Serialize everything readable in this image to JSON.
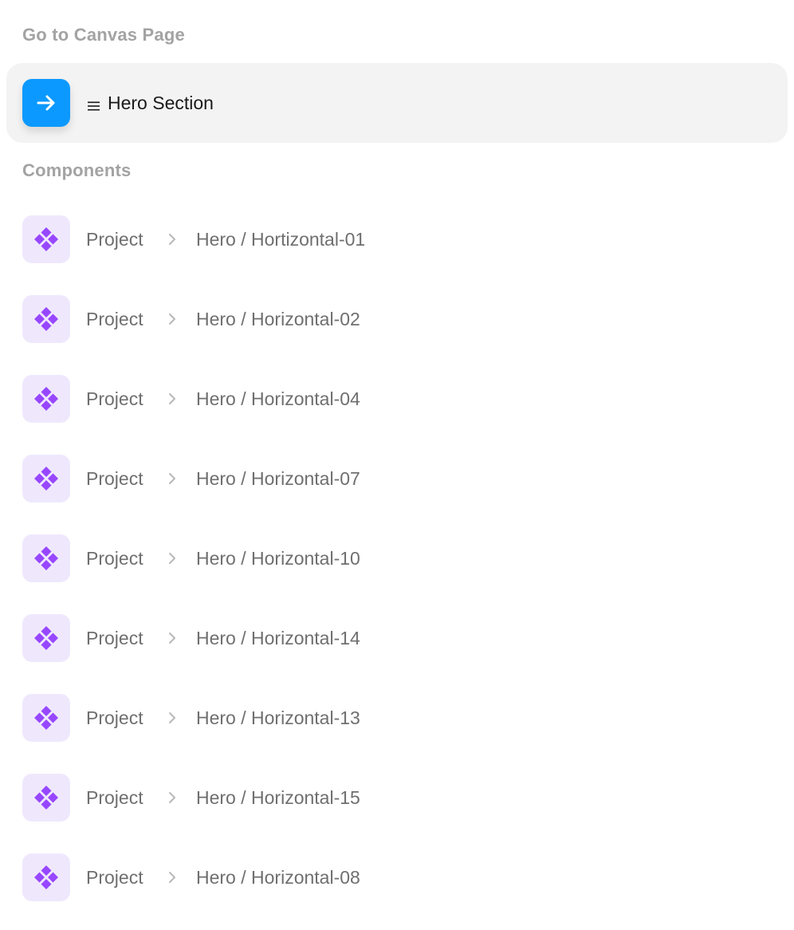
{
  "goto_section": {
    "heading": "Go to Canvas Page",
    "selected": {
      "icon": "arrow-right-icon",
      "frame_icon": "frame-lines-icon",
      "label": "Hero Section"
    }
  },
  "components_section": {
    "heading": "Components",
    "icon": "component-diamond-icon",
    "separator_icon": "chevron-right-icon",
    "items": [
      {
        "project": "Project",
        "name": "Hero / Hortizontal-01"
      },
      {
        "project": "Project",
        "name": "Hero / Horizontal-02"
      },
      {
        "project": "Project",
        "name": "Hero / Horizontal-04"
      },
      {
        "project": "Project",
        "name": "Hero / Horizontal-07"
      },
      {
        "project": "Project",
        "name": "Hero / Horizontal-10"
      },
      {
        "project": "Project",
        "name": "Hero / Horizontal-14"
      },
      {
        "project": "Project",
        "name": "Hero / Horizontal-13"
      },
      {
        "project": "Project",
        "name": "Hero / Horizontal-15"
      },
      {
        "project": "Project",
        "name": "Hero / Horizontal-08"
      }
    ]
  },
  "colors": {
    "accent_blue": "#0b99ff",
    "component_purple": "#9747ff",
    "component_bg": "#efe8fd",
    "selected_row_bg": "#f3f3f3",
    "heading_text": "#a3a3a3",
    "item_text": "#6f6f6f"
  }
}
